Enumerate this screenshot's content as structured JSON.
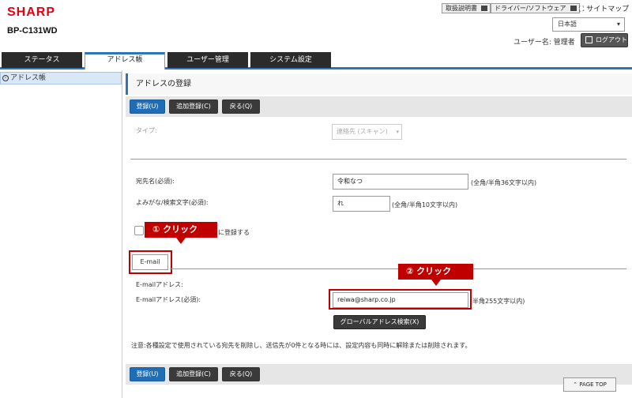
{
  "header": {
    "logo": "SHARP",
    "model": "BP-C131WD",
    "links": [
      "取扱説明書",
      "ドライバー/ソフトウェア"
    ],
    "sitemap": "サイトマップ",
    "language": "日本語",
    "user_label": "ユーザー名: 管理者",
    "logout": "ログアウト"
  },
  "tabs": [
    "ステータス",
    "アドレス帳",
    "ユーザー管理",
    "システム設定"
  ],
  "sidebar": {
    "items": [
      {
        "label": "アドレス帳"
      }
    ]
  },
  "main": {
    "title": "アドレスの登録",
    "buttons": {
      "register": "登録(U)",
      "add_register": "追加登録(C)",
      "back": "戻る(Q)"
    },
    "type_label": "タイプ:",
    "type_value": "連絡先 (スキャン)",
    "name_label": "宛先名(必須):",
    "name_value": "令和なつ",
    "name_hint": "(全角/半角36文字以内)",
    "kana_label": "よみがな/検索文字(必須):",
    "kana_value": "れ",
    "kana_hint": "(全角/半角10文字以内)",
    "checkbox_label": "に登録する",
    "email_tab": "E-mail",
    "email_section_label": "E-mailアドレス:",
    "email_label": "E-mailアドレス(必須):",
    "email_value": "reiwa@sharp.co.jp",
    "email_hint": "半角255文字以内)",
    "global_search": "グローバルアドレス検索(X)",
    "note": "注意:各種設定で使用されている宛先を削除し、送信先が0件となる時には、設定内容も同時に解除または削除されます。",
    "page_top": "PAGE TOP"
  },
  "annotations": {
    "callout1": "① クリック",
    "callout2": "② クリック"
  },
  "colors": {
    "accent": "#2e75b6",
    "callout": "#c00000",
    "brand": "#e60012"
  }
}
